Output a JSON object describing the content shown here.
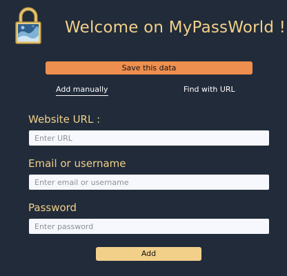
{
  "header": {
    "title": "Welcome on MyPassWorld !",
    "logo_icon": "padlock-icon"
  },
  "toolbar": {
    "save_label": "Save this data"
  },
  "tabs": [
    {
      "label": "Add manually",
      "active": true
    },
    {
      "label": "Find with URL",
      "active": false
    }
  ],
  "form": {
    "url": {
      "label": "Website URL :",
      "placeholder": "Enter URL",
      "value": ""
    },
    "email": {
      "label": "Email or username",
      "placeholder": "Enter email or username",
      "value": ""
    },
    "password": {
      "label": "Password",
      "placeholder": "Enter password",
      "value": ""
    },
    "submit_label": "Add"
  },
  "colors": {
    "background": "#212b3a",
    "accent_yellow": "#f2d08a",
    "accent_orange": "#ee8f4f"
  }
}
